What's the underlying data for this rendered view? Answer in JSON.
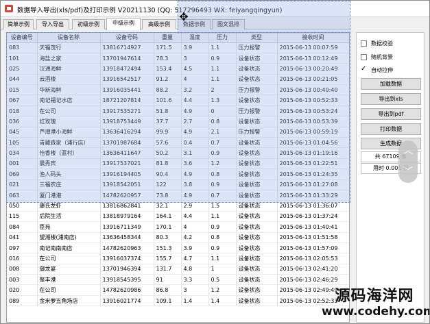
{
  "window": {
    "title": "数据导入导出(xls/pdf)及打印示例 V20211130 (QQ: 517296493 WX: feiyangqingyun)"
  },
  "tabs": [
    {
      "label": "简单示例"
    },
    {
      "label": "导入导出"
    },
    {
      "label": "初级示例"
    },
    {
      "label": "中级示例"
    },
    {
      "label": "高级示例"
    },
    {
      "label": "数据示例"
    },
    {
      "label": "图文混排"
    }
  ],
  "table": {
    "headers": [
      "设备编号",
      "设备名称",
      "设备号码",
      "重量",
      "温度",
      "压力",
      "类型",
      "接收时间"
    ],
    "rows": [
      [
        "083",
        "天福茂行",
        "13816714927",
        "171.5",
        "3.9",
        "1.1",
        "压力报警",
        "2015-06-13 00:07:59"
      ],
      [
        "101",
        "海盐之家",
        "13701947614",
        "78.3",
        "3",
        "0.9",
        "设备状态",
        "2015-06-13 00:12:49"
      ],
      [
        "025",
        "汉通海鲜",
        "13918472494",
        "153.4",
        "4.5",
        "1.1",
        "设备状态",
        "2015-06-13 00:20:49"
      ],
      [
        "044",
        "云酒楼",
        "13916542517",
        "91.2",
        "4",
        "1.1",
        "设备状态",
        "2015-06-13 00:21:05"
      ],
      [
        "015",
        "华新海鲜",
        "13916035441",
        "88.2",
        "3.2",
        "2",
        "压力报警",
        "2015-06-13 00:40:40"
      ],
      [
        "067",
        "南记福记水店",
        "18721207814",
        "101.6",
        "4.4",
        "1.3",
        "设备状态",
        "2015-06-13 00:52:33"
      ],
      [
        "018",
        "在公司",
        "13917535271",
        "51.8",
        "4.9",
        "0",
        "压力报警",
        "2015-06-13 00:53:24"
      ],
      [
        "036",
        "红玫瑰",
        "13918753449",
        "37.7",
        "2.7",
        "0.8",
        "设备状态",
        "2015-06-13 00:53:39"
      ],
      [
        "045",
        "芦潮港小海鲜",
        "13636416294",
        "99.9",
        "4.9",
        "2.1",
        "压力报警",
        "2015-06-13 00:59:19"
      ],
      [
        "105",
        "青藏森家（浦行店）",
        "13701987684",
        "57.6",
        "0.4",
        "0.7",
        "设备状态",
        "2015-06-13 01:04:56"
      ],
      [
        "034",
        "怡香楼（蓝村）",
        "13636411647",
        "50.2",
        "3.1",
        "0.9",
        "设备状态",
        "2015-06-13 01:19:16"
      ],
      [
        "001",
        "晨秀宾",
        "13917537021",
        "81.8",
        "3.6",
        "1.2",
        "设备状态",
        "2015-06-13 01:22:51"
      ],
      [
        "069",
        "渔人码头",
        "13916194405",
        "90.4",
        "4.9",
        "0.8",
        "设备状态",
        "2015-06-13 01:24:35"
      ],
      [
        "021",
        "三福农庄",
        "13918542051",
        "122",
        "3.8",
        "0.9",
        "设备状态",
        "2015-06-13 01:27:08"
      ],
      [
        "063",
        "厦门港港",
        "14782620957",
        "73.8",
        "4.9",
        "0.7",
        "设备状态",
        "2015-06-13 01:33:29"
      ],
      [
        "050",
        "康氏龙虾",
        "13816862841",
        "32.1",
        "2.9",
        "1.5",
        "设备状态",
        "2015-06-13 01:36:07"
      ],
      [
        "115",
        "后院生活",
        "13818979164",
        "164.1",
        "4.4",
        "1.1",
        "设备状态",
        "2015-06-13 01:37:24"
      ],
      [
        "084",
        "臣苑",
        "13916711349",
        "170.1",
        "4",
        "0.9",
        "设备状态",
        "2015-06-13 01:40:41"
      ],
      [
        "041",
        "望湘楼(浦南店)",
        "13636458344",
        "80.3",
        "4.2",
        "0.8",
        "设备状态",
        "2015-06-13 01:51:58"
      ],
      [
        "097",
        "南记南南南店",
        "14782620963",
        "151.3",
        "3.9",
        "0.9",
        "设备状态",
        "2015-06-13 01:57:09"
      ],
      [
        "016",
        "在公司",
        "13916037374",
        "155.7",
        "4.7",
        "1.1",
        "设备状态",
        "2015-06-13 02:05:53"
      ],
      [
        "008",
        "御龙宴",
        "13701946394",
        "131.7",
        "4.8",
        "1",
        "设备状态",
        "2015-06-13 02:41:20"
      ],
      [
        "003",
        "聚丰港",
        "13918545395",
        "91",
        "3.3",
        "0.5",
        "设备状态",
        "2015-06-13 02:46:29"
      ],
      [
        "020",
        "在公司",
        "14782620986",
        "86.8",
        "3",
        "1.2",
        "设备状态",
        "2015-06-13 02:49:49"
      ],
      [
        "089",
        "金米萝五角场店",
        "13916021774",
        "109.1",
        "1.4",
        "1.4",
        "设备状态",
        "2015-06-13 02:52:33"
      ]
    ]
  },
  "sidebar": {
    "checkboxes": [
      {
        "label": "数据校验",
        "checked": false
      },
      {
        "label": "随机背景",
        "checked": false
      },
      {
        "label": "自动拉伸",
        "checked": true,
        "mark": "✓"
      }
    ],
    "buttons": [
      {
        "label": "加载数据"
      },
      {
        "label": "导出到xls"
      },
      {
        "label": "导出到pdf"
      },
      {
        "label": "打印数据"
      },
      {
        "label": "生成数据"
      }
    ],
    "count_label": "共 67109 条",
    "time_label": "用时 0.001 秒"
  },
  "overlay": {
    "move_cursor": "move-cursor-icon",
    "scroll_up": "chevron-up-icon",
    "scroll_down": "chevron-down-icon"
  },
  "watermark": {
    "cn": "源码海洋网",
    "url": "www.codehy.com"
  },
  "colors": {
    "selection": "#91afe6",
    "selection_border": "#6b8cd6",
    "app_icon": "#c94b3b"
  }
}
